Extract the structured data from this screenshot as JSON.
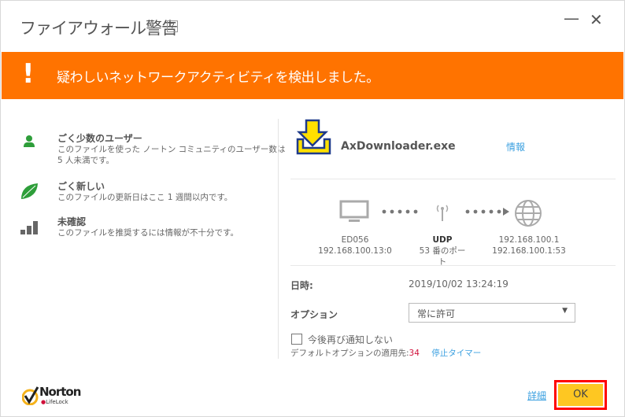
{
  "window": {
    "title": "ファイアウォール警告",
    "help": "?",
    "minimize": "—",
    "close": "✕"
  },
  "banner": {
    "icon": "!",
    "message": "疑わしいネットワークアクティビティを検出しました。",
    "color": "#ff7300"
  },
  "reputation": [
    {
      "icon": "user-icon",
      "title": "ごく少数のユーザー",
      "desc": "このファイルを使った ノートン コミュニティのユーザー数は 5 人未満です。"
    },
    {
      "icon": "leaf-icon",
      "title": "ごく新しい",
      "desc": "このファイルの更新日はここ 1 週間以内です。"
    },
    {
      "icon": "signal-bars-icon",
      "title": "未確認",
      "desc": "このファイルを推奨するには情報が不十分です。"
    }
  ],
  "file": {
    "icon": "download-icon",
    "name": "AxDownloader.exe",
    "info_link": "情報"
  },
  "connection": {
    "source": {
      "name": "ED056",
      "address": "192.168.100.13:0"
    },
    "protocol": {
      "name": "UDP",
      "port": "53 番のポート"
    },
    "destination": {
      "name": "192.168.100.1",
      "address": "192.168.100.1:53"
    }
  },
  "details": {
    "datetime_label": "日時:",
    "datetime": "2019/10/02 13:24:19",
    "option_label": "オプション",
    "option_value": "常に許可"
  },
  "dont_notify": {
    "label": "今後再び通知しない",
    "checked": false
  },
  "default_option": {
    "label": "デフォルトオプションの適用先:",
    "value": "34",
    "timer_link": "停止タイマー"
  },
  "footer": {
    "logo": {
      "brand": "Norton",
      "sub": "LifeLock"
    },
    "details_link": "詳細",
    "ok": "OK"
  }
}
